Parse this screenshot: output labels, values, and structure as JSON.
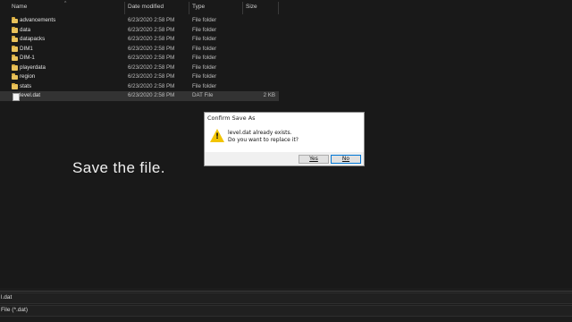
{
  "columns": {
    "name": "Name",
    "date_modified": "Date modified",
    "type": "Type",
    "size": "Size"
  },
  "files": [
    {
      "name": "advancements",
      "date": "6/23/2020 2:58 PM",
      "type": "File folder",
      "size": "",
      "icon": "folder-icon"
    },
    {
      "name": "data",
      "date": "6/23/2020 2:58 PM",
      "type": "File folder",
      "size": "",
      "icon": "folder-icon"
    },
    {
      "name": "datapacks",
      "date": "6/23/2020 2:58 PM",
      "type": "File folder",
      "size": "",
      "icon": "folder-icon"
    },
    {
      "name": "DIM1",
      "date": "6/23/2020 2:58 PM",
      "type": "File folder",
      "size": "",
      "icon": "folder-icon"
    },
    {
      "name": "DIM-1",
      "date": "6/23/2020 2:58 PM",
      "type": "File folder",
      "size": "",
      "icon": "folder-icon"
    },
    {
      "name": "playerdata",
      "date": "6/23/2020 2:58 PM",
      "type": "File folder",
      "size": "",
      "icon": "folder-icon"
    },
    {
      "name": "region",
      "date": "6/23/2020 2:58 PM",
      "type": "File folder",
      "size": "",
      "icon": "folder-icon"
    },
    {
      "name": "stats",
      "date": "6/23/2020 2:58 PM",
      "type": "File folder",
      "size": "",
      "icon": "folder-icon"
    },
    {
      "name": "level.dat",
      "date": "6/23/2020 2:58 PM",
      "type": "DAT File",
      "size": "2 KB",
      "icon": "file-icon"
    }
  ],
  "overlay_caption": "Save the file.",
  "dialog": {
    "title": "Confirm Save As",
    "message_line1": "level.dat already exists.",
    "message_line2": "Do you want to replace it?",
    "yes_label": "Yes",
    "no_label": "No",
    "icon": "warning-icon"
  },
  "bottom": {
    "filename_value": "l.dat",
    "filetype_value": "File (*.dat)"
  },
  "colors": {
    "background": "#191919",
    "selected_row": "#333333",
    "folder": "#e8c15a",
    "dialog_focus_border": "#0078d7",
    "warning": "#f2c400"
  }
}
